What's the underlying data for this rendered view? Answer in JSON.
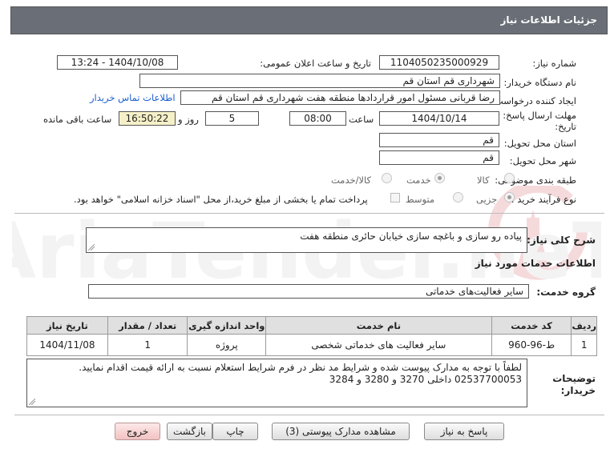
{
  "panel": {
    "title": "جزئیات اطلاعات نیاز"
  },
  "form": {
    "need_number_label": "شماره نیاز:",
    "need_number": "1104050235000929",
    "announce_label": "تاریخ و ساعت اعلان عمومی:",
    "announce_value": "1404/10/08 - 13:24",
    "buyer_label": "نام دستگاه خریدار:",
    "buyer_value": "شهرداری قم استان قم",
    "creator_label": "ایجاد کننده درخواست:",
    "creator_value": "رضا قربانی مسئول امور قراردادها منطقه هفت شهرداری قم استان قم",
    "contact_link": "اطلاعات تماس خریدار",
    "deadline_label_1": "مهلت ارسال پاسخ: تا",
    "deadline_label_2": "تاریخ:",
    "deadline_date": "1404/10/14",
    "time_label": "ساعت",
    "deadline_time": "08:00",
    "days_value": "5",
    "days_label": "روز و",
    "remaining_time": "16:50:22",
    "remaining_label": "ساعت باقی مانده",
    "province_label": "استان محل تحویل:",
    "province_value": "قم",
    "city_label": "شهر محل تحویل:",
    "city_value": "قم",
    "category_label": "طبقه بندی موضوعی:",
    "category_options": [
      "کالا",
      "خدمت",
      "کالا/خدمت"
    ],
    "category_selected": "خدمت",
    "process_label": "نوع فرآیند خرید :",
    "process_options": [
      "جزیی",
      "متوسط"
    ],
    "process_selected": "جزیی",
    "payment_note": "پرداخت تمام یا بخشی از مبلغ خرید،از محل \"اسناد خزانه اسلامی\" خواهد بود."
  },
  "summary": {
    "label": "شرح کلی نیاز:",
    "value": "پیاده رو سازی و باغچه سازی خیابان حائری منطقه هفت",
    "services_title": "اطلاعات خدمات مورد نیاز",
    "group_label": "گروه خدمت:",
    "group_value": "سایر فعالیت‌های خدماتی"
  },
  "table": {
    "headers": [
      "ردیف",
      "کد خدمت",
      "نام خدمت",
      "واحد اندازه گیری",
      "تعداد / مقدار",
      "تاریخ نیاز"
    ],
    "rows": [
      [
        "1",
        "ط-96-960",
        "سایر فعالیت های خدماتی شخصی",
        "پروژه",
        "1",
        "1404/11/08"
      ]
    ]
  },
  "notes": {
    "label_1": "توضیحات",
    "label_2": "خریدار:",
    "text": "لطفاً با توجه به مدارک پیوست شده و شرایط مد نظر در فرم شرایط استعلام نسبت به ارائه قیمت اقدام نمایید. 02537700053 داخلی 3270 و 3280 و 3284"
  },
  "buttons": {
    "reply": "پاسخ به نیاز",
    "attachments": "مشاهده مدارک پیوستی (3)",
    "print": "چاپ",
    "back": "بازگشت",
    "exit": "خروج"
  },
  "colors": {
    "titlebar": "#6a6e76",
    "link": "#1a5fd0",
    "remaining_bg": "#f6f0c8",
    "exit_bg": "#f3c2c2"
  },
  "watermark": {
    "text": "AriaTender.neT"
  }
}
